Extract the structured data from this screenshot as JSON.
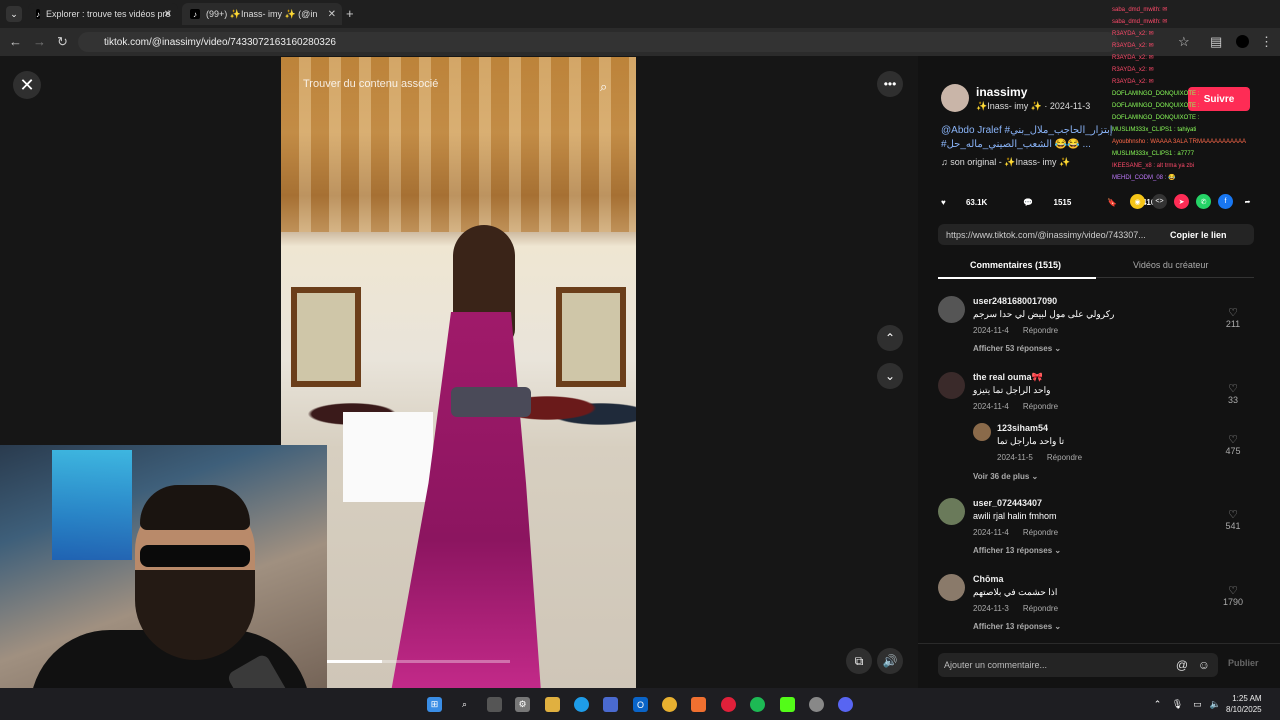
{
  "browser": {
    "tabs": [
      {
        "label": "Explorer : trouve tes vidéos pré"
      },
      {
        "label": "(99+) ✨Inass- imy ✨ (@in"
      }
    ],
    "new_tab_symbol": "+",
    "url": "tiktok.com/@inassimy/video/7433072163160280326"
  },
  "video": {
    "search_placeholder": "Trouver du contenu associé",
    "progress": 0.3
  },
  "creator": {
    "username": "inassimy",
    "display_line": "✨Inass- imy ✨ · 2024-11-3",
    "follow_label": "Suivre",
    "description_line1": "@Abdo Jralef #إبتزار_الحاجب_ملال_بني",
    "description_line2": "#الشعب_الصيني_ماله_حل 😂😂 ...",
    "music": "son original - ✨Inass- imy ✨"
  },
  "stats": {
    "likes": "63.1K",
    "comments": "1515",
    "saves": "6410"
  },
  "link": {
    "url": "https://www.tiktok.com/@inassimy/video/743307...",
    "copy_label": "Copier le lien"
  },
  "panel_tabs": {
    "comments": "Commentaires (1515)",
    "creator_videos": "Vidéos du créateur"
  },
  "comments": [
    {
      "user": "user2481680017090",
      "text": "ركرولي على مول لبيض لي حدا سرجم",
      "date": "2024-11-4",
      "reply": "Répondre",
      "more": "Afficher 53 réponses ⌄",
      "likes": "211"
    },
    {
      "user": "the real ouma🎀",
      "text": "واحد الراجل تما يتيزو",
      "date": "2024-11-4",
      "reply": "Répondre",
      "more": "",
      "likes": "33"
    },
    {
      "user": "123siham54",
      "text": "تا واحد ماراجل تما",
      "date": "2024-11-5",
      "reply": "Répondre",
      "more": "Voir 36 de plus ⌄",
      "likes": "475"
    },
    {
      "user": "user_072443407",
      "text": "awili rjal halin fmhom",
      "date": "2024-11-4",
      "reply": "Répondre",
      "more": "Afficher 13 réponses ⌄",
      "likes": "541"
    },
    {
      "user": "Chōma",
      "text": "اذا حشمت في بلاصتهم",
      "date": "2024-11-3",
      "reply": "Répondre",
      "more": "Afficher 13 réponses ⌄",
      "likes": "1790"
    }
  ],
  "add_comment": {
    "placeholder": "Ajouter un commentaire...",
    "publish": "Publier"
  },
  "chat": [
    {
      "text": "saba_dmd_mwith: ✉",
      "color": "#ff4a6a"
    },
    {
      "text": "saba_dmd_mwith: ✉",
      "color": "#ff4a6a"
    },
    {
      "text": "R3AYDA_x2: ✉",
      "color": "#ff4a6a"
    },
    {
      "text": "R3AYDA_x2: ✉",
      "color": "#ff4a6a"
    },
    {
      "text": "R3AYDA_x2: ✉",
      "color": "#ff4a6a"
    },
    {
      "text": "R3AYDA_x2: ✉",
      "color": "#ff4a6a"
    },
    {
      "text": "R3AYDA_x2: ✉",
      "color": "#ff4a6a"
    },
    {
      "text": "DOFLAMINGO_DONQUIXOTE :",
      "color": "#8bff5a"
    },
    {
      "text": "DOFLAMINGO_DONQUIXOTE :",
      "color": "#8bff5a"
    },
    {
      "text": "DOFLAMINGO_DONQUIXOTE :",
      "color": "#8bff5a"
    },
    {
      "text": "MUSLIM333x_CLIPS1 : tahiyati",
      "color": "#8bff5a"
    },
    {
      "text": "Ayoubhnsho : WAAAA 3ALA TRMAAAAAAAAAAA",
      "color": "#ff6a4a"
    },
    {
      "text": "MUSLIM333x_CLIPS1 : a7777",
      "color": "#8bff5a"
    },
    {
      "text": "IKEESANE_x8 : alt trma ya zbi",
      "color": "#ff4a6a"
    },
    {
      "text": "MEHDI_CODM_08 : 😂",
      "color": "#c07aff"
    }
  ],
  "clock": {
    "time": "1:25 AM",
    "date": "8/10/2025"
  },
  "colors": {
    "accent": "#fe2c55",
    "link": "#8ab4f8"
  }
}
